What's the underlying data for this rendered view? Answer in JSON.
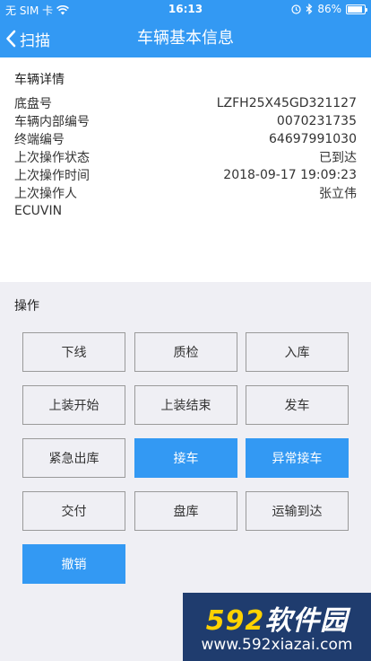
{
  "status_bar": {
    "carrier": "无 SIM 卡",
    "time": "16:13",
    "battery": "86%",
    "icons": [
      "wifi-icon",
      "alarm-icon",
      "bluetooth-icon",
      "battery-icon"
    ]
  },
  "nav": {
    "back_label": "扫描",
    "title": "车辆基本信息"
  },
  "details": {
    "title": "车辆详情",
    "rows": [
      {
        "label": "底盘号",
        "value": "LZFH25X45GD321127"
      },
      {
        "label": "车辆内部编号",
        "value": "0070231735"
      },
      {
        "label": "终端编号",
        "value": "64697991030"
      },
      {
        "label": "上次操作状态",
        "value": "已到达"
      },
      {
        "label": "上次操作时间",
        "value": "2018-09-17 19:09:23"
      },
      {
        "label": "上次操作人",
        "value": "张立伟"
      },
      {
        "label": "ECUVIN",
        "value": ""
      }
    ]
  },
  "operations": {
    "title": "操作",
    "buttons": [
      {
        "label": "下线",
        "style": "default"
      },
      {
        "label": "质检",
        "style": "default"
      },
      {
        "label": "入库",
        "style": "default"
      },
      {
        "label": "上装开始",
        "style": "default"
      },
      {
        "label": "上装结束",
        "style": "default"
      },
      {
        "label": "发车",
        "style": "default"
      },
      {
        "label": "紧急出库",
        "style": "default"
      },
      {
        "label": "接车",
        "style": "primary"
      },
      {
        "label": "异常接车",
        "style": "primary"
      },
      {
        "label": "交付",
        "style": "default"
      },
      {
        "label": "盘库",
        "style": "default"
      },
      {
        "label": "运输到达",
        "style": "default"
      },
      {
        "label": "撤销",
        "style": "primary"
      }
    ]
  },
  "watermark": {
    "logo_number": "592",
    "logo_text": "软件园",
    "url": "www.592xiazai.com"
  },
  "colors": {
    "primary": "#3399f3",
    "background": "#efeff4",
    "card": "#ffffff",
    "border": "#9a9a9a"
  }
}
